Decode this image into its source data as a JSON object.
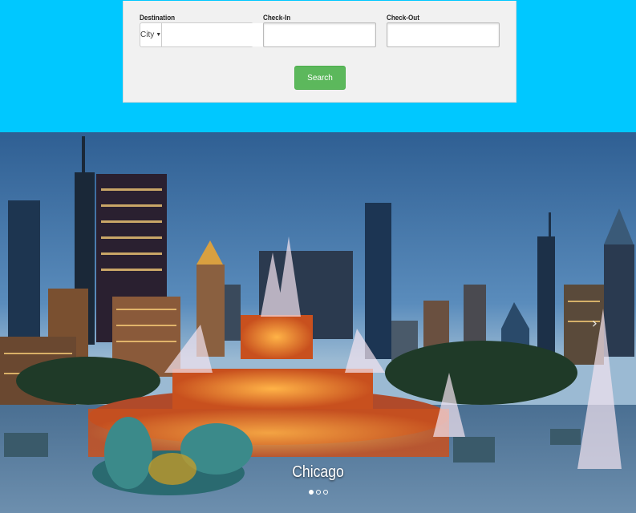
{
  "search": {
    "destination_label": "Destination",
    "destination_type": "City",
    "destination_value": "",
    "checkin_label": "Check-In",
    "checkin_value": "",
    "checkout_label": "Check-Out",
    "checkout_value": "",
    "search_button": "Search"
  },
  "carousel": {
    "caption": "Chicago",
    "slide_count": 3,
    "active_slide": 1,
    "next_icon": "chevron-right-icon",
    "next_glyph": "›"
  },
  "colors": {
    "top_background": "#00c8ff",
    "search_button": "#5cb85c",
    "panel": "#f1f1f1"
  }
}
